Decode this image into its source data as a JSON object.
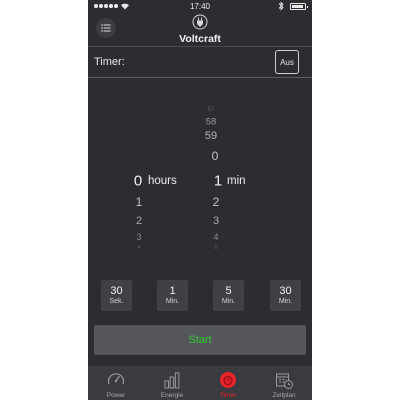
{
  "status_bar": {
    "time": "17:40"
  },
  "header": {
    "title": "Voltcraft"
  },
  "timer": {
    "label": "Timer:",
    "toggle_label": "Aus"
  },
  "picker": {
    "hours_value": "0",
    "hours_unit": "hours",
    "minutes_value": "1",
    "minutes_unit": "min",
    "minutes_above": [
      "57",
      "58",
      "59",
      "0"
    ],
    "hours_below": [
      "1",
      "2",
      "3",
      "4"
    ],
    "minutes_below": [
      "2",
      "3",
      "4",
      "5"
    ]
  },
  "presets": [
    {
      "value": "30",
      "unit": "Sek."
    },
    {
      "value": "1",
      "unit": "Min."
    },
    {
      "value": "5",
      "unit": "Min."
    },
    {
      "value": "30",
      "unit": "Min."
    }
  ],
  "start_label": "Start",
  "tabs": [
    {
      "label": "Power",
      "icon": "gauge-icon"
    },
    {
      "label": "Energie",
      "icon": "bar-chart-icon"
    },
    {
      "label": "Timer",
      "icon": "stopwatch-icon",
      "active": true
    },
    {
      "label": "Zeitplan",
      "icon": "calendar-clock-icon"
    }
  ],
  "colors": {
    "background": "#2c2d30",
    "start_text": "#33cc33",
    "active_tab": "#e8232a"
  }
}
